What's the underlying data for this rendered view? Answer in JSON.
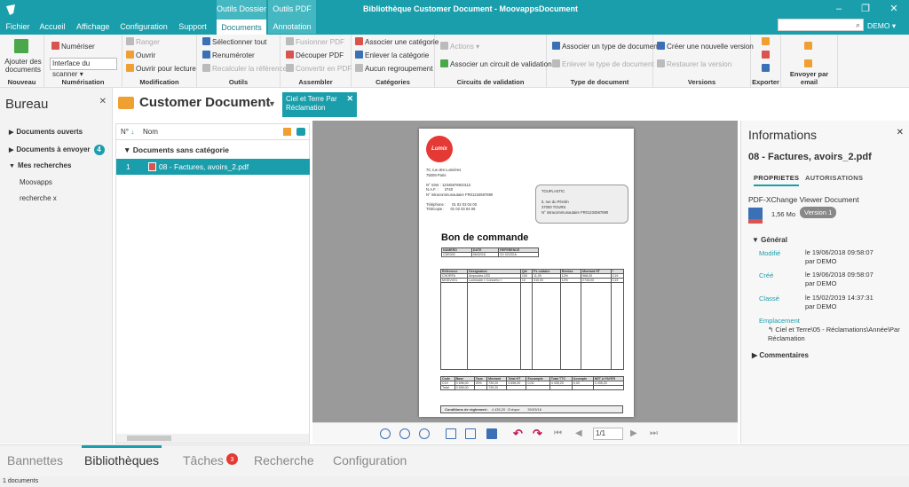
{
  "window": {
    "title": "Bibliothèque Customer Document - MoovappsDocument",
    "user": "DEMO"
  },
  "context_tabs": [
    "Outils Dossier",
    "Outils PDF"
  ],
  "menu": [
    {
      "label": "Fichier"
    },
    {
      "label": "Accueil"
    },
    {
      "label": "Affichage"
    },
    {
      "label": "Configuration"
    },
    {
      "label": "Support"
    },
    {
      "label": "Documents",
      "active": true
    },
    {
      "label": "Annotation"
    }
  ],
  "ribbon": {
    "nouveau": {
      "title": "Nouveau",
      "ajouter": "Ajouter des documents"
    },
    "numerisation": {
      "title": "Numérisation",
      "numeriser": "Numériser",
      "scanner": "Interface du scanner"
    },
    "modification": {
      "title": "Modification",
      "ranger": "Ranger",
      "ouvrir": "Ouvrir",
      "ouvrir_lecture": "Ouvrir pour lecture"
    },
    "outils": {
      "title": "Outils",
      "selectionner": "Sélectionner tout",
      "renumeroter": "Renuméroter",
      "recalculer": "Recalculer la référence"
    },
    "assembler": {
      "title": "Assembler",
      "fusionner": "Fusionner PDF",
      "decouper": "Découper PDF",
      "convertir": "Convertir en PDF"
    },
    "categories": {
      "title": "Catégories",
      "associer": "Associer une catégorie",
      "enlever": "Enlever la catégorie",
      "aucun": "Aucun regroupement"
    },
    "circuits": {
      "title": "Circuits de validation",
      "actions": "Actions",
      "associer": "Associer un circuit de validation"
    },
    "type": {
      "title": "Type de document",
      "associer": "Associer un type de document",
      "enlever": "Enlever le type de document"
    },
    "versions": {
      "title": "Versions",
      "creer": "Créer une nouvelle version",
      "restaurer": "Restaurer la version"
    },
    "exporter": {
      "title": "Exporter"
    },
    "email": {
      "title": "Envoyer par email"
    }
  },
  "sidebar": {
    "title": "Bureau",
    "items": [
      {
        "label": "Documents ouverts"
      },
      {
        "label": "Documents à envoyer",
        "badge": "4"
      },
      {
        "label": "Mes recherches"
      }
    ],
    "searches": [
      "Moovapps",
      "recherche x"
    ]
  },
  "library": {
    "title": "Customer Document",
    "filter_chip": "Ciel et Terre Par Réclamation"
  },
  "list": {
    "col_num": "N°",
    "col_name": "Nom",
    "group": "Documents sans catégorie",
    "rows": [
      {
        "num": "1",
        "name": "08 - Factures, avoirs_2.pdf"
      }
    ]
  },
  "document": {
    "brand": "Lumix",
    "sender_address": "70, rue des Lumières\n75009 Paris\n\nN° Siret : 12345678910112\nN.A.F. :      2740\nN° intracommunautaire FR01234567890\n\nTéléphone :      01 02 03 04 00\nTélécopie :      01 02 03 04 06",
    "client_address": "TOUPLASTIC\n\n5, rue du Pérolin\n37000 TOURS\nN° intracommunautaire FR01234567890",
    "title": "Bon de commande",
    "header": {
      "numero": "CDE000",
      "date": "06/02/16",
      "reference": "SV 02/2016"
    },
    "header_labels": [
      "NUMERO",
      "DATE",
      "REFERENCE"
    ],
    "lines_headers": [
      "Référence",
      "Désignation",
      "Qté",
      "Px unitaire",
      "Remise",
      "Montant HT",
      "*"
    ],
    "lines": [
      [
        "CHORFA",
        "Ampoules LED",
        "100",
        "11,00",
        "12%",
        "968,00",
        "C19"
      ],
      [
        "MODVV01",
        "Luminaire « Concerto »",
        "10",
        "310,00",
        "12%",
        "2728,00",
        "C19"
      ]
    ],
    "totals_headers": [
      "Code",
      "Base",
      "Taux",
      "Montant",
      "Total HT",
      "Escompte",
      "Total TTC",
      "Acompte",
      "NET A PAYER"
    ],
    "totals": [
      "C19",
      "3 696,00",
      "20%",
      "739,20",
      "3 696,00",
      "0,00",
      "4 435,20",
      "0,00",
      "4 435,20"
    ],
    "total_row": [
      "Total",
      "3 696,00",
      "",
      "739,20"
    ],
    "conditions": {
      "label": "Conditions de règlement :",
      "amount": "4 435,20",
      "mode": "Chèque",
      "date": "30/03/16"
    }
  },
  "viewer": {
    "page": "1/1"
  },
  "info": {
    "title": "Informations",
    "filename": "08 - Factures, avoirs_2.pdf",
    "tabs": [
      "PROPRIETES",
      "AUTORISATIONS"
    ],
    "viewer_name": "PDF-XChange Viewer Document",
    "size": "1,56 Mo",
    "version": "Version 1",
    "general": "Général",
    "fields": [
      {
        "label": "Modifié",
        "value": "le 19/06/2018 09:58:07",
        "by": "par DEMO"
      },
      {
        "label": "Créé",
        "value": "le 19/06/2018 09:58:07",
        "by": "par DEMO"
      },
      {
        "label": "Classé",
        "value": "le 15/02/2019 14:37:31",
        "by": "par DEMO"
      }
    ],
    "emplacement_label": "Emplacement",
    "emplacement_value": "Ciel et Terre\\05 - Réclamations\\Année\\Par Réclamation",
    "commentaires": "Commentaires"
  },
  "bottom_tabs": [
    {
      "label": "Bannettes"
    },
    {
      "label": "Bibliothèques",
      "active": true
    },
    {
      "label": "Tâches",
      "badge": "3"
    },
    {
      "label": "Recherche"
    },
    {
      "label": "Configuration"
    }
  ],
  "status": "1 documents",
  "colors": {
    "accent": "#1a9eab",
    "badge_red": "#e53935"
  }
}
